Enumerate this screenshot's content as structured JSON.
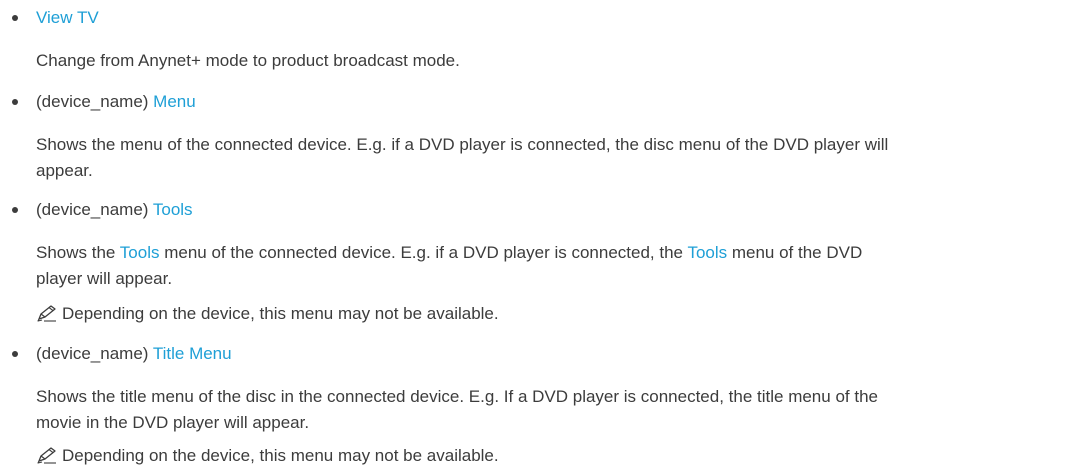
{
  "items": [
    {
      "prefix": "",
      "link": "View TV",
      "description": [
        "Change from Anynet+ mode to product broadcast mode."
      ],
      "note": ""
    },
    {
      "prefix": "(device_name) ",
      "link": "Menu",
      "description": [
        "Shows the menu of the connected device. E.g. if a DVD player is connected, the disc menu of the DVD player will",
        "appear."
      ],
      "note": ""
    },
    {
      "prefix": "(device_name) ",
      "link": "Tools",
      "description_parts": {
        "a": "Shows the ",
        "b": "Tools",
        "c": " menu of the connected device. E.g. if a DVD player is connected, the ",
        "d": "Tools",
        "e": " menu of the DVD",
        "f": "player will appear."
      },
      "note": "Depending on the device, this menu may not be available."
    },
    {
      "prefix": "(device_name) ",
      "link": "Title Menu",
      "description": [
        "Shows the title menu of the disc in the connected device. E.g. If a DVD player is connected, the title menu of the",
        "movie in the DVD player will appear."
      ],
      "note": "Depending on the device, this menu may not be available."
    }
  ],
  "colors": {
    "text": "#3c3c3c",
    "link": "#1e9fd6"
  },
  "icons": {
    "note": "pencil-note-icon"
  }
}
